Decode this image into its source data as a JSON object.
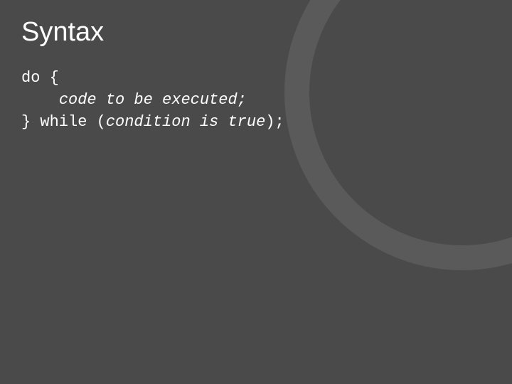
{
  "slide": {
    "title": "Syntax",
    "code": {
      "line1_keyword": "do ",
      "line1_brace": "{",
      "line2_indent": "    ",
      "line2_text": "code to be executed;",
      "line3_brace": "} ",
      "line3_keyword": "while ",
      "line3_paren_open": "(",
      "line3_condition": "condition is true",
      "line3_paren_close": ");"
    }
  }
}
